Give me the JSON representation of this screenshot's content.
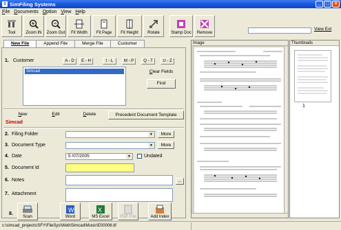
{
  "window": {
    "title": "SimFiling Systems"
  },
  "menu": [
    "File",
    "Documents",
    "Option",
    "View",
    "Help"
  ],
  "toolbar": {
    "buttons": [
      "Tool",
      "Zoom IN",
      "Zoom Out",
      "Fit Width",
      "Fit Page",
      "Fit Height",
      "Rotate",
      "Stamp Doc",
      "Remove"
    ],
    "search_value": "",
    "view_ext_label": "View Ext"
  },
  "tabs": [
    "New File",
    "Append File",
    "Merge File",
    "Customer"
  ],
  "customer": {
    "label": "Customer",
    "number": "1.",
    "alpha": [
      "A - D",
      "E - H",
      "I - L",
      "M - P",
      "Q - T",
      "U - Z"
    ],
    "selected": "Simcad",
    "clear_fields": "Clear Fields",
    "find": "Find"
  },
  "actions": {
    "new": "New",
    "edit": "Edit",
    "delete": "Delete",
    "precedent": "Precedent Document Template"
  },
  "current_customer": "Simcad",
  "fields": {
    "filing_folder": {
      "num": "2.",
      "label": "Filing Folder",
      "more": "More"
    },
    "document_type": {
      "num": "3.",
      "label": "Document Type",
      "more": "More"
    },
    "date": {
      "num": "4.",
      "label": "Date",
      "value": "5 /07/2005",
      "undated": "Undated"
    },
    "document_id": {
      "num": "5.",
      "label": "Document Id"
    },
    "notes": {
      "num": "6.",
      "label": "Notes",
      "button": "..."
    },
    "attachment": {
      "num": "7.",
      "label": "Attachment"
    }
  },
  "file_buttons": {
    "num": "8.",
    "labels": [
      "Scan",
      "Word",
      "MS Excel",
      "PDF File",
      "Add Index"
    ]
  },
  "panes": {
    "image": "Image",
    "thumbnails": "Thumbnails",
    "page": "1"
  },
  "status": {
    "path": "c:\\simcad_projects\\SFY\\FileSys\\Web\\Simcad\\Music\\E00006.tif"
  },
  "colors": {
    "title_bar": "#0c45c9",
    "selection": "#316ac5",
    "doc_id_field": "#ffff80",
    "customer_text": "#c00000"
  }
}
